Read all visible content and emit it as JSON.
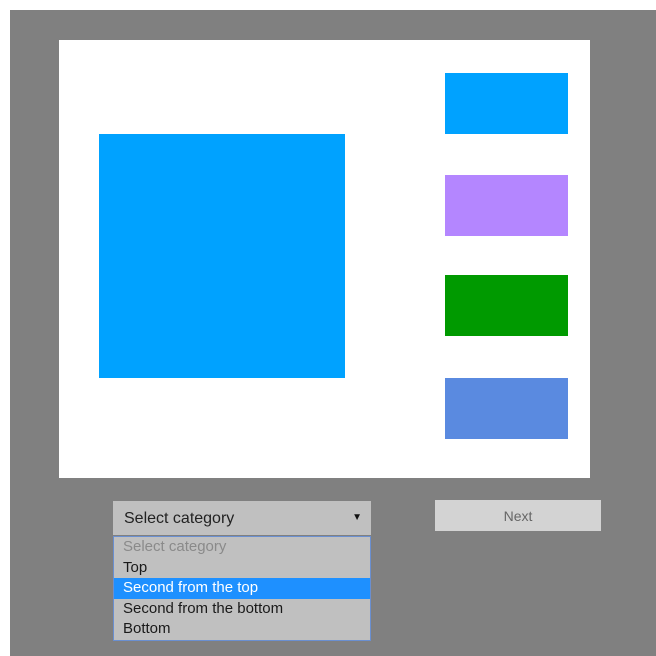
{
  "stimulus": {
    "canvas_color": "#ffffff",
    "target_color": "#00a2ff",
    "swatches": [
      {
        "position": "top",
        "color": "#00a2ff"
      },
      {
        "position": "second-from-top",
        "color": "#b486ff"
      },
      {
        "position": "second-from-bottom",
        "color": "#009a00"
      },
      {
        "position": "bottom",
        "color": "#5a8ae0"
      }
    ]
  },
  "category_select": {
    "selected_label": "Select category",
    "arrow": "▼",
    "options": [
      {
        "label": "Select category",
        "state": "placeholder"
      },
      {
        "label": "Top",
        "state": "normal"
      },
      {
        "label": "Second from the top",
        "state": "highlighted"
      },
      {
        "label": "Second from the bottom",
        "state": "normal"
      },
      {
        "label": "Bottom",
        "state": "normal"
      }
    ]
  },
  "next_button": {
    "label": "Next"
  }
}
